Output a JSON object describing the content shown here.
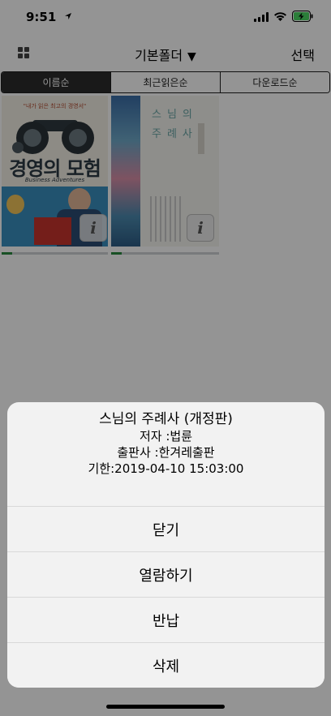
{
  "status_bar": {
    "time": "9:51",
    "location_icon": "location-arrow-icon",
    "signal_icon": "cellular-signal-icon",
    "wifi_icon": "wifi-icon",
    "battery_icon": "battery-charging-icon",
    "battery_color": "#4cd964"
  },
  "nav": {
    "grid_icon": "grid-view-icon",
    "folder_title": "기본폴더",
    "folder_caret": "▼",
    "select_label": "선택"
  },
  "tabs": [
    {
      "label": "이름순",
      "active": true
    },
    {
      "label": "최근읽은순",
      "active": false
    },
    {
      "label": "다운로드순",
      "active": false
    }
  ],
  "books": [
    {
      "cover_tagline": "\"내가 읽은 최고의 경영서\"",
      "cover_title": "경영의 모험",
      "cover_subtitle": "Business Adventures",
      "info_icon": "info-icon",
      "progress": 0.1
    },
    {
      "cover_title_line1": "스님의",
      "cover_title_line2": "주례사",
      "info_icon": "info-icon",
      "progress": 0.1
    }
  ],
  "sheet": {
    "title": "스님의 주례사 (개정판)",
    "author": "저자 :법륜",
    "publisher": "출판사 :한겨레출판",
    "deadline": "기한:2019-04-10 15:03:00",
    "actions": [
      "닫기",
      "열람하기",
      "반납",
      "삭제"
    ]
  },
  "colors": {
    "accent_dark": "#2b2b2b",
    "progress_fill": "#2a8a3e",
    "overlay": "rgba(0,0,0,0.42)",
    "sheet_bg": "#f2f2f2"
  }
}
